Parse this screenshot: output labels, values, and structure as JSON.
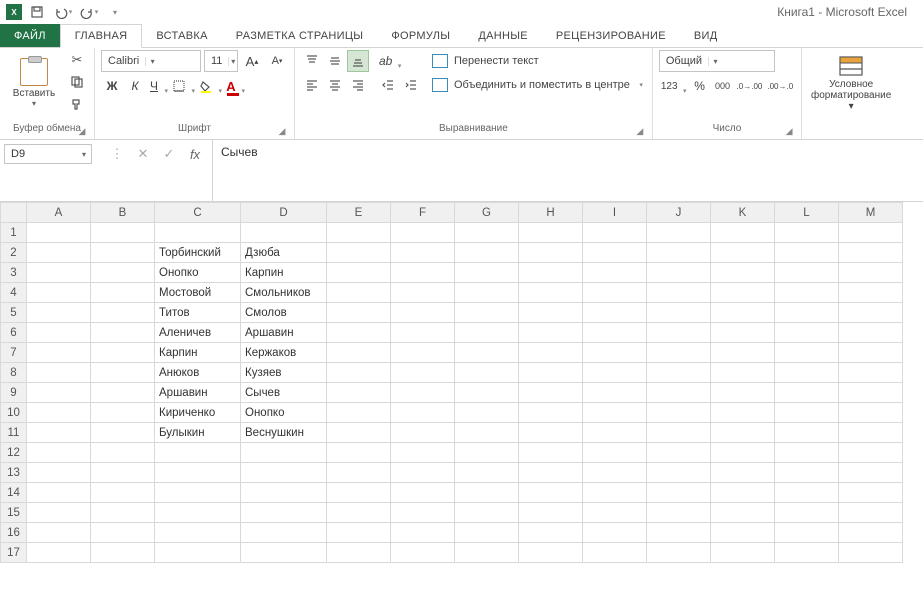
{
  "app": {
    "title": "Книга1 - Microsoft Excel"
  },
  "tabs": {
    "file": "ФАЙЛ",
    "home": "ГЛАВНАЯ",
    "insert": "ВСТАВКА",
    "pagelayout": "РАЗМЕТКА СТРАНИЦЫ",
    "formulas": "ФОРМУЛЫ",
    "data": "ДАННЫЕ",
    "review": "РЕЦЕНЗИРОВАНИЕ",
    "view": "ВИД"
  },
  "ribbon": {
    "clipboard": {
      "label": "Буфер обмена",
      "paste": "Вставить"
    },
    "font": {
      "label": "Шрифт",
      "name": "Calibri",
      "size": "11",
      "bold": "Ж",
      "italic": "К",
      "underline": "Ч"
    },
    "align": {
      "label": "Выравнивание",
      "wrap": "Перенести текст",
      "merge": "Объединить и поместить в центре"
    },
    "number": {
      "label": "Число",
      "format": "Общий"
    },
    "cf": {
      "label1": "Условное",
      "label2": "форматирование"
    }
  },
  "fbar": {
    "name": "D9",
    "formula": "Сычев"
  },
  "sheet": {
    "cols": [
      "A",
      "B",
      "C",
      "D",
      "E",
      "F",
      "G",
      "H",
      "I",
      "J",
      "K",
      "L",
      "M"
    ],
    "rows": [
      {
        "n": "1",
        "C": "",
        "D": ""
      },
      {
        "n": "2",
        "C": "Торбинский",
        "D": "Дзюба"
      },
      {
        "n": "3",
        "C": "Онопко",
        "D": "Карпин"
      },
      {
        "n": "4",
        "C": "Мостовой",
        "D": "Смольников"
      },
      {
        "n": "5",
        "C": "Титов",
        "D": "Смолов"
      },
      {
        "n": "6",
        "C": "Аленичев",
        "D": "Аршавин"
      },
      {
        "n": "7",
        "C": "Карпин",
        "D": "Кержаков"
      },
      {
        "n": "8",
        "C": "Анюков",
        "D": "Кузяев"
      },
      {
        "n": "9",
        "C": "Аршавин",
        "D": "Сычев"
      },
      {
        "n": "10",
        "C": "Кириченко",
        "D": "Онопко"
      },
      {
        "n": "11",
        "C": "Булыкин",
        "D": "Веснушкин"
      },
      {
        "n": "12",
        "C": "",
        "D": ""
      },
      {
        "n": "13",
        "C": "",
        "D": ""
      },
      {
        "n": "14",
        "C": "",
        "D": ""
      },
      {
        "n": "15",
        "C": "",
        "D": ""
      },
      {
        "n": "16",
        "C": "",
        "D": ""
      },
      {
        "n": "17",
        "C": "",
        "D": ""
      }
    ]
  }
}
